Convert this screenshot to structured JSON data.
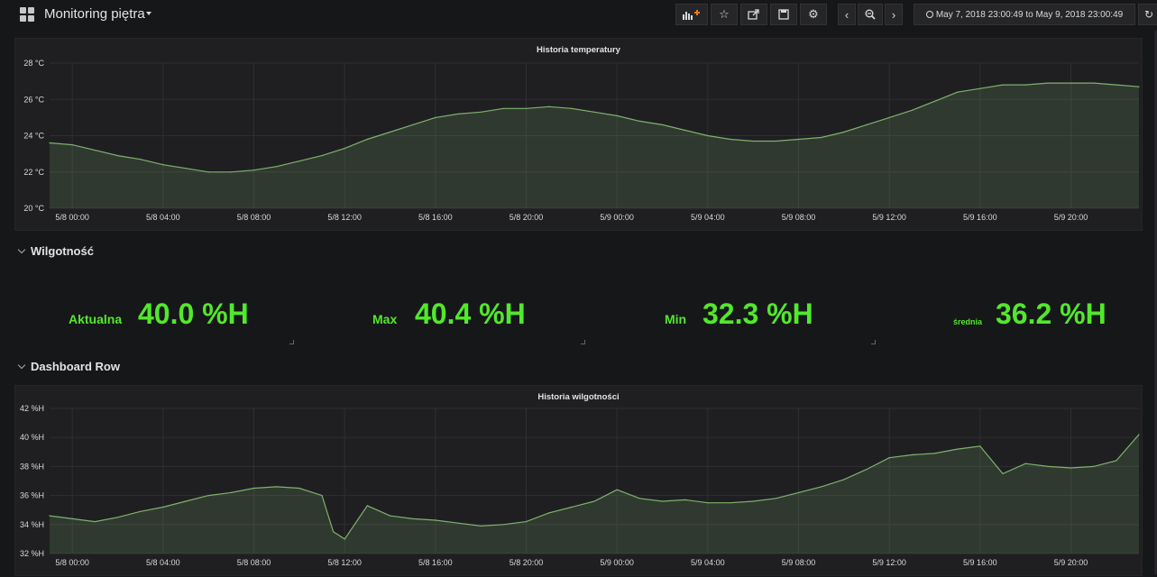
{
  "navbar": {
    "title": "Monitoring piętra",
    "time_range": "May 7, 2018 23:00:49 to May 9, 2018 23:00:49",
    "icons": [
      "dashboard-grid-icon",
      "add-panel-icon",
      "star-icon",
      "share-icon",
      "save-icon",
      "settings-icon",
      "chevron-left-icon",
      "zoom-out-icon",
      "chevron-right-icon",
      "clock-icon",
      "refresh-icon"
    ]
  },
  "colors": {
    "background": "#161719",
    "panel": "#1f1f22",
    "series_line": "#7eb26d",
    "stat_value": "#52e82b"
  },
  "rows": [
    {
      "title": "Wilgotność"
    },
    {
      "title": "Dashboard Row"
    }
  ],
  "stats": [
    {
      "prefix": "Aktualna",
      "value": "40.0 %H"
    },
    {
      "prefix": "Max",
      "value": "40.4 %H"
    },
    {
      "prefix": "Min",
      "value": "32.3 %H"
    },
    {
      "prefix": "średnia",
      "value": "36.2 %H"
    }
  ],
  "chart_data": [
    {
      "type": "area",
      "title": "Historia temperatury",
      "unit": "°C",
      "x_tick_labels": [
        "5/8 00:00",
        "5/8 04:00",
        "5/8 08:00",
        "5/8 12:00",
        "5/8 16:00",
        "5/8 20:00",
        "5/9 00:00",
        "5/9 04:00",
        "5/9 08:00",
        "5/9 12:00",
        "5/9 16:00",
        "5/9 20:00"
      ],
      "y_tick_labels": [
        "28 °C",
        "26 °C",
        "24 °C",
        "22 °C",
        "20 °C"
      ],
      "ylim": [
        20,
        28
      ],
      "xlim_hours": [
        -1,
        47
      ],
      "grid": true,
      "series": [
        {
          "x_hours": [
            -1,
            0,
            1,
            2,
            3,
            4,
            5,
            6,
            7,
            8,
            9,
            10,
            11,
            12,
            13,
            14,
            15,
            16,
            17,
            18,
            19,
            20,
            21,
            22,
            23,
            24,
            25,
            26,
            27,
            28,
            29,
            30,
            31,
            32,
            33,
            34,
            35,
            36,
            37,
            38,
            39,
            40,
            41,
            42,
            43,
            44,
            45,
            46,
            47
          ],
          "values": [
            23.6,
            23.5,
            23.2,
            22.9,
            22.7,
            22.4,
            22.2,
            22.0,
            22.0,
            22.1,
            22.3,
            22.6,
            22.9,
            23.3,
            23.8,
            24.2,
            24.6,
            25.0,
            25.2,
            25.3,
            25.5,
            25.5,
            25.6,
            25.5,
            25.3,
            25.1,
            24.8,
            24.6,
            24.3,
            24.0,
            23.8,
            23.7,
            23.7,
            23.8,
            23.9,
            24.2,
            24.6,
            25.0,
            25.4,
            25.9,
            26.4,
            26.6,
            26.8,
            26.8,
            26.9,
            26.9,
            26.9,
            26.8,
            26.7
          ]
        }
      ]
    },
    {
      "type": "area",
      "title": "Historia wilgotności",
      "unit": "%H",
      "x_tick_labels": [
        "5/8 00:00",
        "5/8 04:00",
        "5/8 08:00",
        "5/8 12:00",
        "5/8 16:00",
        "5/8 20:00",
        "5/9 00:00",
        "5/9 04:00",
        "5/9 08:00",
        "5/9 12:00",
        "5/9 16:00",
        "5/9 20:00"
      ],
      "y_tick_labels": [
        "42 %H",
        "40 %H",
        "38 %H",
        "36 %H",
        "34 %H",
        "32 %H"
      ],
      "ylim": [
        32,
        42
      ],
      "xlim_hours": [
        -1,
        47
      ],
      "grid": true,
      "series": [
        {
          "x_hours": [
            -1,
            0,
            1,
            2,
            3,
            4,
            5,
            6,
            7,
            8,
            9,
            10,
            11,
            11.5,
            12,
            13,
            14,
            15,
            16,
            17,
            18,
            19,
            20,
            21,
            22,
            23,
            24,
            25,
            26,
            27,
            28,
            29,
            30,
            31,
            32,
            33,
            34,
            35,
            36,
            37,
            38,
            39,
            40,
            41,
            42,
            43,
            44,
            45,
            46,
            47
          ],
          "values": [
            34.6,
            34.4,
            34.2,
            34.5,
            34.9,
            35.2,
            35.6,
            36.0,
            36.2,
            36.5,
            36.6,
            36.5,
            36.0,
            33.5,
            33.0,
            35.3,
            34.6,
            34.4,
            34.3,
            34.1,
            33.9,
            34.0,
            34.2,
            34.8,
            35.2,
            35.6,
            36.4,
            35.8,
            35.6,
            35.7,
            35.5,
            35.5,
            35.6,
            35.8,
            36.2,
            36.6,
            37.1,
            37.8,
            38.6,
            38.8,
            38.9,
            39.2,
            39.4,
            37.5,
            38.2,
            38.0,
            37.9,
            38.0,
            38.4,
            40.2
          ]
        }
      ]
    }
  ]
}
